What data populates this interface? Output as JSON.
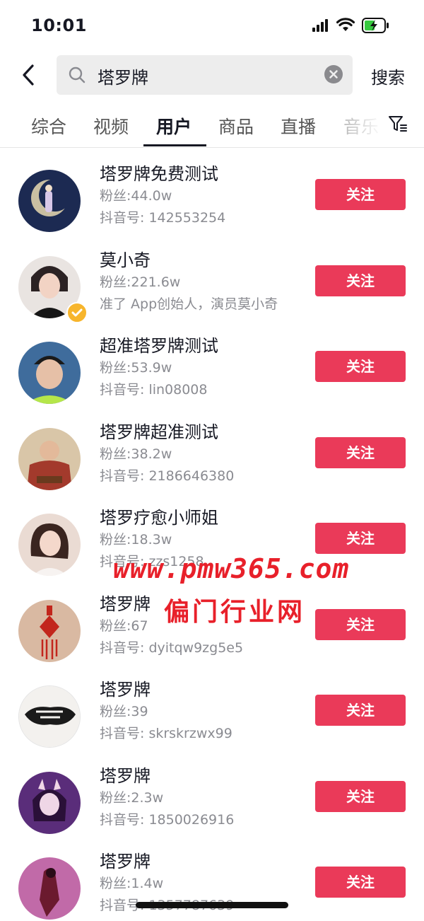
{
  "status_bar": {
    "time": "10:01"
  },
  "search": {
    "query": "塔罗牌",
    "submit_label": "搜索"
  },
  "tabs": [
    {
      "label": "综合",
      "active": false
    },
    {
      "label": "视频",
      "active": false
    },
    {
      "label": "用户",
      "active": true
    },
    {
      "label": "商品",
      "active": false
    },
    {
      "label": "直播",
      "active": false
    },
    {
      "label": "音乐",
      "active": false
    }
  ],
  "follow_label": "关注",
  "users": [
    {
      "name": "塔罗牌免费测试",
      "fans": "粉丝:44.0w",
      "detail": "抖音号: 142553254",
      "verified": false,
      "avatar_color": "#1c2a52"
    },
    {
      "name": "莫小奇",
      "fans": "粉丝:221.6w",
      "detail": "准了 App创始人，演员莫小奇",
      "verified": true,
      "avatar_color": "#e9e4e1"
    },
    {
      "name": "超准塔罗牌测试",
      "fans": "粉丝:53.9w",
      "detail": "抖音号: lin08008",
      "verified": false,
      "avatar_color": "#3f6c9c"
    },
    {
      "name": "塔罗牌超准测试",
      "fans": "粉丝:38.2w",
      "detail": "抖音号: 2186646380",
      "verified": false,
      "avatar_color": "#a33a2c"
    },
    {
      "name": "塔罗疗愈小师姐",
      "fans": "粉丝:18.3w",
      "detail": "抖音号: zzs1258",
      "verified": false,
      "avatar_color": "#eadbd3"
    },
    {
      "name": "塔罗牌",
      "fans": "粉丝:67",
      "detail": "抖音号: dyitqw9zg5e5",
      "verified": false,
      "avatar_color": "#d9b9a2"
    },
    {
      "name": "塔罗牌",
      "fans": "粉丝:39",
      "detail": "抖音号: skrskrzwx99",
      "verified": false,
      "avatar_color": "#f3f1ee"
    },
    {
      "name": "塔罗牌",
      "fans": "粉丝:2.3w",
      "detail": "抖音号: 1850026916",
      "verified": false,
      "avatar_color": "#5a2d7a"
    },
    {
      "name": "塔罗牌",
      "fans": "粉丝:1.4w",
      "detail": "抖音号: 1357787639",
      "verified": false,
      "avatar_color": "#c16aa8"
    }
  ],
  "watermark": {
    "line1": "www.pmw365.com",
    "line2": "偏门行业网"
  },
  "colors": {
    "accent": "#ea3a59",
    "text_primary": "#161823",
    "text_secondary": "#8a8b91",
    "search_bg": "#ededed",
    "verified": "#f7b52c"
  },
  "icons": {
    "back": "chevron-left-icon",
    "search": "magnifier-icon",
    "clear": "close-circle-icon",
    "filter": "filter-icon",
    "signal": "signal-icon",
    "wifi": "wifi-icon",
    "battery": "battery-charging-icon",
    "verified": "verified-check-icon"
  }
}
